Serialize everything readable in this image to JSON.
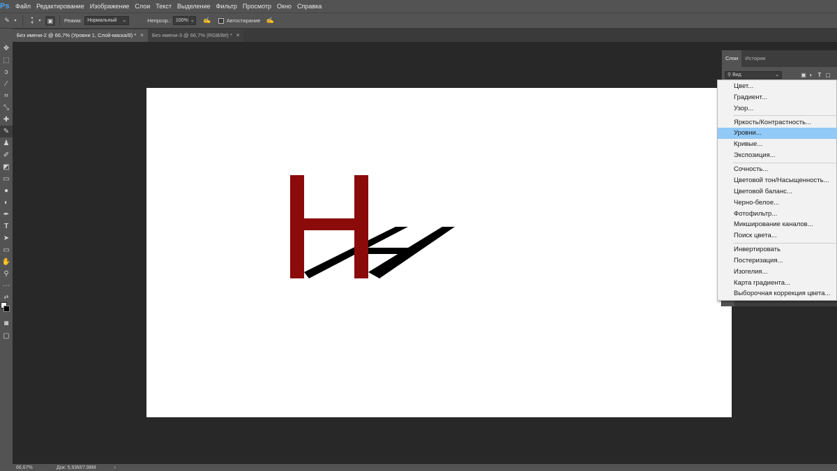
{
  "app": {
    "logo": "Ps"
  },
  "menu": [
    "Файл",
    "Редактирование",
    "Изображение",
    "Слои",
    "Текст",
    "Выделение",
    "Фильтр",
    "Просмотр",
    "Окно",
    "Справка"
  ],
  "options": {
    "brush_size": "4",
    "mode_label": "Режим:",
    "mode_value": "Нормальный",
    "opacity_label": "Непрозр.:",
    "opacity_value": "100%",
    "autoerase_label": "Автостирание"
  },
  "tabs": [
    {
      "label": "Без имени-2 @ 66,7% (Уровни 1, Слой-маска/8) *",
      "active": true
    },
    {
      "label": "Без имени-3 @ 66,7% (RGB/8#) *",
      "active": false
    }
  ],
  "panel": {
    "tabs": [
      "Слои",
      "История"
    ],
    "filter": "Вид"
  },
  "adjustment_menu": [
    [
      "Цвет...",
      "Градиент...",
      "Узор..."
    ],
    [
      "Яркость/Контрастность...",
      "Уровни...",
      "Кривые...",
      "Экспозиция..."
    ],
    [
      "Сочность...",
      "Цветовой тон/Насыщенность...",
      "Цветовой баланс...",
      "Черно-белое...",
      "Фотофильтр...",
      "Микширование каналов...",
      "Поиск цвета..."
    ],
    [
      "Инвертировать",
      "Постеризация...",
      "Изогелия...",
      "Карта градиента...",
      "Выборочная коррекция цвета..."
    ]
  ],
  "highlighted_item": "Уровни...",
  "status": {
    "zoom": "66,67%",
    "doc": "Док: 5,93M/7,98M"
  },
  "colors": {
    "letter": "#8b0a0a",
    "shadow": "#000000",
    "menu_highlight": "#91c9f7",
    "foreground": "#ffffff",
    "background": "#000000"
  }
}
